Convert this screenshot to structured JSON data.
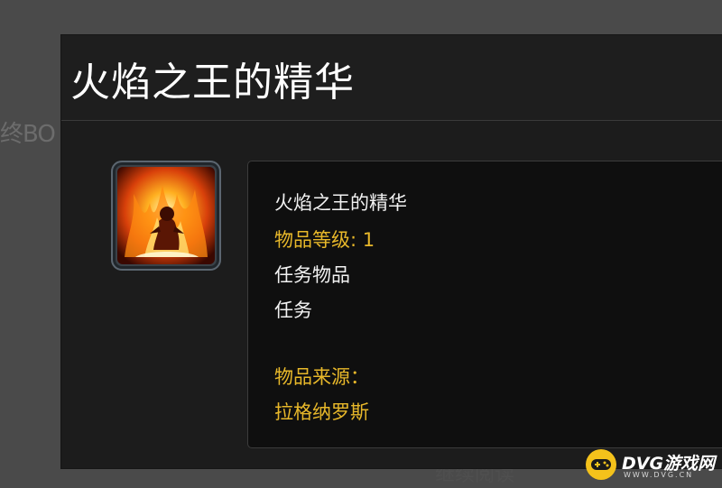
{
  "background": {
    "partial_text": "终BO",
    "bottom_text": "继续阅读"
  },
  "dialog": {
    "title": "火焰之王的精华"
  },
  "item": {
    "icon": "fire-lord-essence-icon",
    "name": "火焰之王的精华",
    "item_level": "物品等级: 1",
    "type": "任务物品",
    "category": "任务",
    "source_label": "物品来源：",
    "source": "拉格纳罗斯"
  },
  "watermark": {
    "brand": "DVG游戏网",
    "url": "WWW.DVG.CN"
  },
  "colors": {
    "gold": "#e8b82a",
    "tooltip_bg": "#0f0f0f",
    "dialog_bg": "#1c1c1c",
    "logo_yellow": "#f4c21b"
  }
}
